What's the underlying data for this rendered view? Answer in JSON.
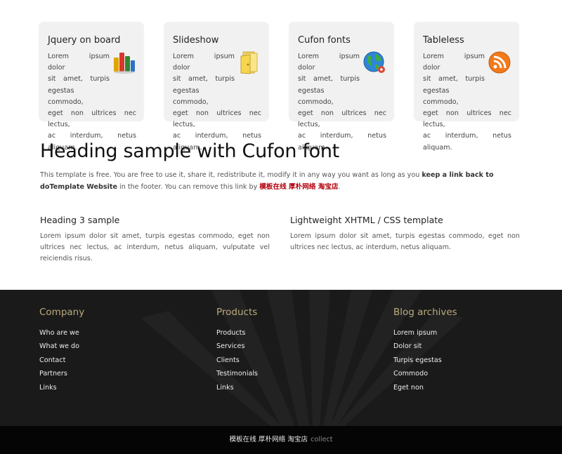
{
  "features": [
    {
      "title": "Jquery on board",
      "short_lines": [
        "Lorem ipsum dolor",
        "sit amet, turpis",
        "egestas commodo,"
      ],
      "long_lines": [
        "eget non ultrices nec lectus,",
        "ac interdum, netus aliquam."
      ],
      "icon": "bar-chart-icon"
    },
    {
      "title": "Slideshow",
      "short_lines": [
        "Lorem ipsum dolor",
        "sit amet, turpis",
        "egestas commodo,"
      ],
      "long_lines": [
        "eget non ultrices nec lectus,",
        "ac interdum, netus aliquam."
      ],
      "icon": "folder-icon"
    },
    {
      "title": "Cufon fonts",
      "short_lines": [
        "Lorem ipsum dolor",
        "sit amet, turpis",
        "egestas commodo,"
      ],
      "long_lines": [
        "eget non ultrices nec lectus,",
        "ac interdum, netus aliquam."
      ],
      "icon": "globe-icon"
    },
    {
      "title": "Tableless",
      "short_lines": [
        "Lorem ipsum dolor",
        "sit amet, turpis",
        "egestas commodo,"
      ],
      "long_lines": [
        "eget non ultrices nec lectus,",
        "ac interdum, netus aliquam."
      ],
      "icon": "rss-icon"
    }
  ],
  "heading": "Heading sample with Cufon font",
  "intro": {
    "text1": "This template is free. You are free to use it, share it, redistribute it, modify it in any way you want as long as you ",
    "bold": "keep a link back to doTemplate Website",
    "text2": " in the footer. You can remove this link by ",
    "link": "模板在线 厚朴网络 淘宝店",
    "end": "."
  },
  "columns": [
    {
      "title": "Heading 3 sample",
      "text": "Lorem ipsum dolor sit amet, turpis egestas commodo, eget non ultrices nec lectus, ac interdum, netus aliquam, vulputate vel reiciendis risus."
    },
    {
      "title": "Lightweight XHTML / CSS template",
      "text": "Lorem ipsum dolor sit amet, turpis egestas commodo, eget non ultrices nec lectus, ac interdum, netus aliquam."
    }
  ],
  "footer": {
    "columns": [
      {
        "title": "Company",
        "links": [
          "Who are we",
          "What we do",
          "Contact",
          "Partners",
          "Links"
        ]
      },
      {
        "title": "Products",
        "links": [
          "Products",
          "Services",
          "Clients",
          "Testimonials",
          "Links"
        ]
      },
      {
        "title": "Blog archives",
        "links": [
          "Lorem ipsum",
          "Dolor sit",
          "Turpis egestas",
          "Commodo",
          "Eget non"
        ]
      }
    ],
    "bottom": {
      "site": "模板在线 厚朴网络 淘宝店",
      "collect": "collect"
    }
  },
  "colors": {
    "footer_heading": "#b9aa7d",
    "link_red": "#b3000c",
    "footer_bg": "#1a1a1a"
  }
}
